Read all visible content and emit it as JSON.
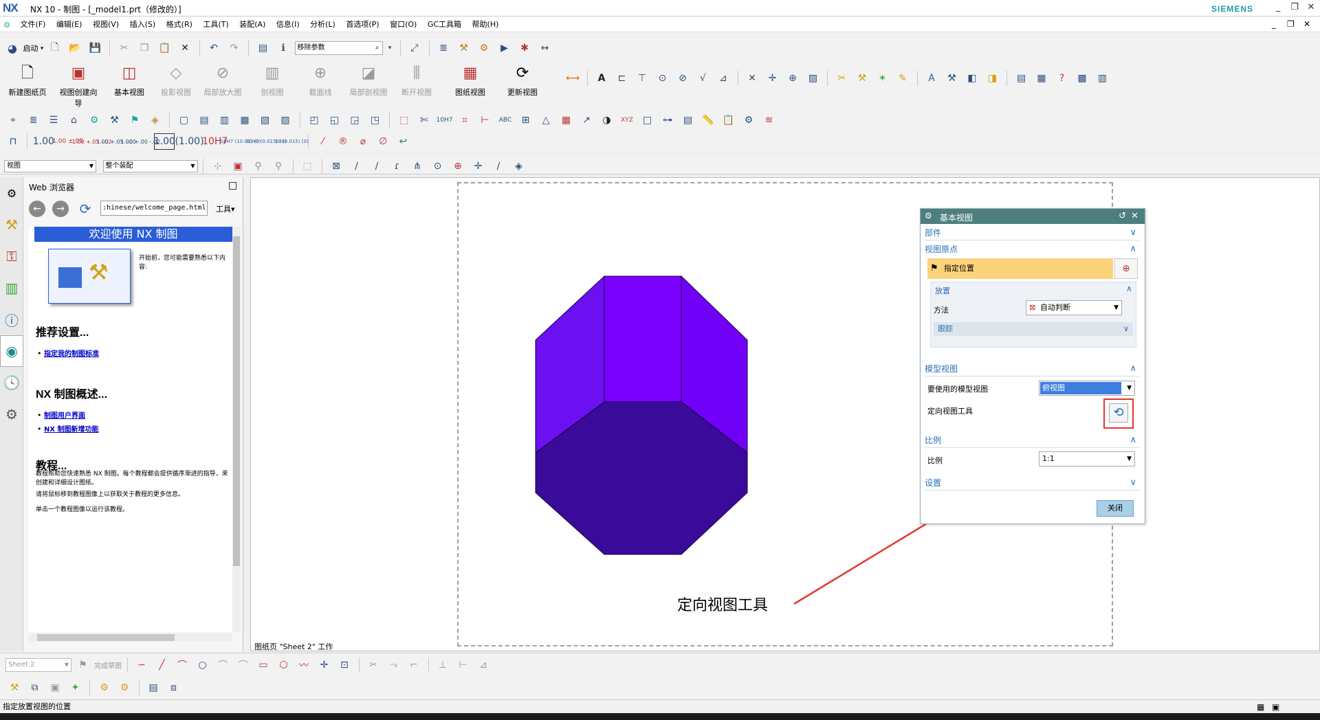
{
  "window": {
    "logo": "NX",
    "title": "NX 10 - 制图 - [_model1.prt（修改的）]",
    "brand": "SIEMENS",
    "controls": [
      "_",
      "❐",
      "✕"
    ]
  },
  "menu": [
    "文件(F)",
    "编辑(E)",
    "视图(V)",
    "插入(S)",
    "格式(R)",
    "工具(T)",
    "装配(A)",
    "信息(I)",
    "分析(L)",
    "首选项(P)",
    "窗口(O)",
    "GC工具箱",
    "帮助(H)"
  ],
  "toolbar1": {
    "start_label": "启动",
    "command_search_placeholder": "移除参数"
  },
  "ribbon": {
    "new_sheet": "新建图纸页",
    "view_wizard": "视图创建向导",
    "base_view": "基本视图",
    "projected_view": "投影视图",
    "detail_view": "局部放大图",
    "section_view": "剖视图",
    "section_line": "截面线",
    "break_out_section": "局部剖视图",
    "broken_view": "断开视图",
    "drawing_view": "图纸视图",
    "update_view": "更新视图"
  },
  "dim_toolbar": [
    "1.00",
    "1.00 ±.05",
    "1.00 +.05 -.02",
    "1.00 +.05 -.00",
    "1.00 +.00 -.02",
    "1.00",
    "(1.00)",
    "10H7",
    "10H7 (10.01) (0)",
    "10H7 (0.015) (0)",
    "10 (0.015) (0)"
  ],
  "filter_bar": {
    "filter1": "视图",
    "filter2": "整个装配"
  },
  "web_browser": {
    "title": "Web 浏览器",
    "url": ":hinese/welcome_page.html",
    "tools": "工具",
    "banner": "欢迎使用 NX 制图",
    "intro": "开始前，您可能需要熟悉以下内容:",
    "h_recommended": "推荐设置...",
    "link_standard": "指定我的制图标准",
    "h_overview": "NX 制图概述...",
    "link_ui": "制图用户界面",
    "link_new": "NX 制图新增功能",
    "h_tutorial": "教程...",
    "tut_p1": "教程帮助您快速熟悉 NX 制图。每个教程都会提供循序渐进的指导，来创建和详细设计图纸。",
    "tut_p2": "请将鼠标移到教程图像上以获取关于教程的更多信息。",
    "tut_p3": "单击一个教程图像以运行该教程。"
  },
  "graphics": {
    "sheet_label": "图纸页 \"Sheet 2\" 工作",
    "annotation": "定向视图工具",
    "colors": {
      "face_light": "#7a00ff",
      "face_mid": "#6b10f0",
      "face_dark": "#3a0a9a",
      "arrow": "#e8342c"
    }
  },
  "dialog": {
    "title": "基本视图",
    "sec_part": "部件",
    "sec_origin": "视图原点",
    "specify_location": "指定位置",
    "sub_placement": "放置",
    "method_label": "方法",
    "method_value": "自动判断",
    "track": "跟踪",
    "sec_model_view": "模型视图",
    "model_view_label": "要使用的模型视图",
    "model_view_value": "俯视图",
    "orient_tool_label": "定向视图工具",
    "sec_scale": "比例",
    "scale_label": "比例",
    "scale_value": "1:1",
    "sec_settings": "设置",
    "close": "关闭"
  },
  "bottom": {
    "sheet_select": "Sheet 2",
    "finish_sketch": "完成草图"
  },
  "status": "指定放置视图的位置"
}
